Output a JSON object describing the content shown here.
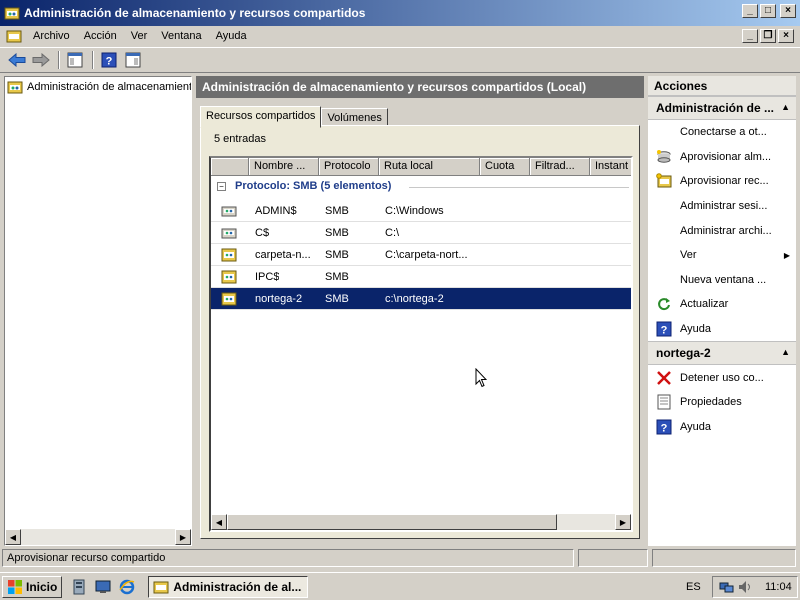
{
  "window": {
    "title": "Administración de almacenamiento y recursos compartidos"
  },
  "menubar": {
    "items": [
      "Archivo",
      "Acción",
      "Ver",
      "Ventana",
      "Ayuda"
    ]
  },
  "tree": {
    "items": [
      {
        "label": "Administración de almacenamiento y recursos compartidos"
      }
    ]
  },
  "center": {
    "header": "Administración de almacenamiento y recursos compartidos (Local)",
    "tabs": [
      "Recursos compartidos",
      "Volúmenes"
    ],
    "entries": "5 entradas",
    "columns": [
      "",
      "Nombre ...",
      "Protocolo",
      "Ruta local",
      "Cuota",
      "Filtrad...",
      "Instant"
    ],
    "group": {
      "toggle": "−",
      "title": "Protocolo: SMB (5 elementos)"
    },
    "rows": [
      {
        "name": "ADMIN$",
        "protocol": "SMB",
        "path": "C:\\Windows",
        "icon": "admin-share-icon",
        "selected": false
      },
      {
        "name": "C$",
        "protocol": "SMB",
        "path": "C:\\",
        "icon": "admin-share-icon",
        "selected": false
      },
      {
        "name": "carpeta-n...",
        "protocol": "SMB",
        "path": "C:\\carpeta-nort...",
        "icon": "share-icon",
        "selected": false
      },
      {
        "name": "IPC$",
        "protocol": "SMB",
        "path": "",
        "icon": "share-icon",
        "selected": false
      },
      {
        "name": "nortega-2",
        "protocol": "SMB",
        "path": "c:\\nortega-2",
        "icon": "share-icon",
        "selected": true
      }
    ]
  },
  "actions": {
    "title": "Acciones",
    "sections": [
      {
        "title": "Administración de ...",
        "items": [
          {
            "label": "Conectarse a ot...",
            "icon": ""
          },
          {
            "label": "Aprovisionar alm...",
            "icon": "provision-storage-icon"
          },
          {
            "label": "Aprovisionar rec...",
            "icon": "provision-share-icon"
          },
          {
            "label": "Administrar sesi...",
            "icon": ""
          },
          {
            "label": "Administrar archi...",
            "icon": ""
          },
          {
            "label": "Ver",
            "icon": "",
            "submenu": true
          },
          {
            "label": "Nueva ventana ...",
            "icon": ""
          },
          {
            "label": "Actualizar",
            "icon": "refresh-icon"
          },
          {
            "label": "Ayuda",
            "icon": "help-icon"
          }
        ]
      },
      {
        "title": "nortega-2",
        "items": [
          {
            "label": "Detener uso co...",
            "icon": "stop-sharing-icon"
          },
          {
            "label": "Propiedades",
            "icon": "properties-icon"
          },
          {
            "label": "Ayuda",
            "icon": "help-icon"
          }
        ]
      }
    ]
  },
  "statusbar": {
    "text": "Aprovisionar recurso compartido"
  },
  "taskbar": {
    "start": "Inicio",
    "task": "Administración de al...",
    "lang": "ES",
    "clock": "11:04"
  },
  "colors": {
    "selection": "#0a246a",
    "group_title": "#1f3d8a",
    "header_bg": "#6e6e6e"
  }
}
